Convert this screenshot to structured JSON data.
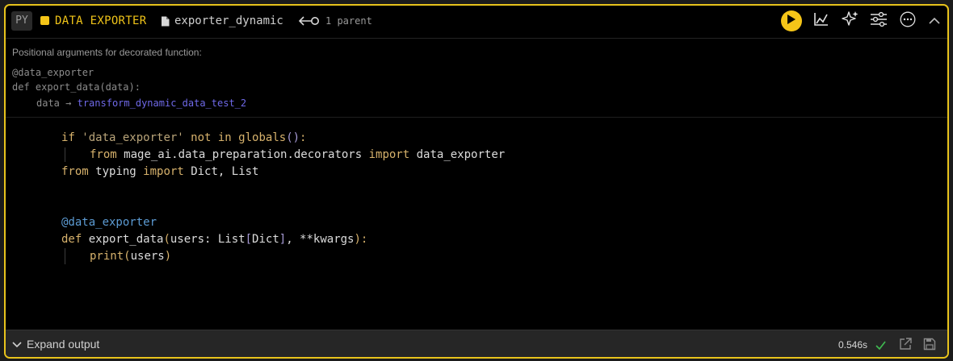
{
  "header": {
    "lang_badge": "PY",
    "block_type": "DATA EXPORTER",
    "file_name": "exporter_dynamic",
    "parents": "1 parent",
    "colors": {
      "accent": "#f5c518",
      "border": "#e8c31c"
    },
    "icons": [
      "play-icon",
      "chart-icon",
      "sparkle-icon",
      "sliders-icon",
      "more-icon",
      "chevron-up-icon"
    ]
  },
  "args": {
    "title": "Positional arguments for decorated function:",
    "decorator": "@data_exporter",
    "signature": "def export_data(data):",
    "param": "data",
    "arrow": "→",
    "upstream": "transform_dynamic_data_test_2"
  },
  "code": {
    "line1": {
      "a": "if ",
      "b": "'data_exporter'",
      "c": " not in ",
      "d": "globals",
      "e": "()",
      "f": ":"
    },
    "line2": {
      "a": "from ",
      "b": "mage_ai.data_preparation.decorators ",
      "c": "import ",
      "d": "data_exporter"
    },
    "line3": {
      "a": "from ",
      "b": "typing ",
      "c": "import ",
      "d": "Dict, List"
    },
    "line6": {
      "a": "@data_exporter"
    },
    "line7": {
      "a": "def ",
      "b": "export_data",
      "c": "(",
      "d": "users: List",
      "e": "[",
      "f": "Dict",
      "g": "]",
      "h": ", **kwargs",
      "i": ")",
      "j": ":"
    },
    "line8": {
      "a": "print",
      "b": "(",
      "c": "users",
      "d": ")"
    }
  },
  "footer": {
    "expand_label": "Expand output",
    "duration": "0.546s",
    "status": "success",
    "success_color": "#3fb950"
  }
}
